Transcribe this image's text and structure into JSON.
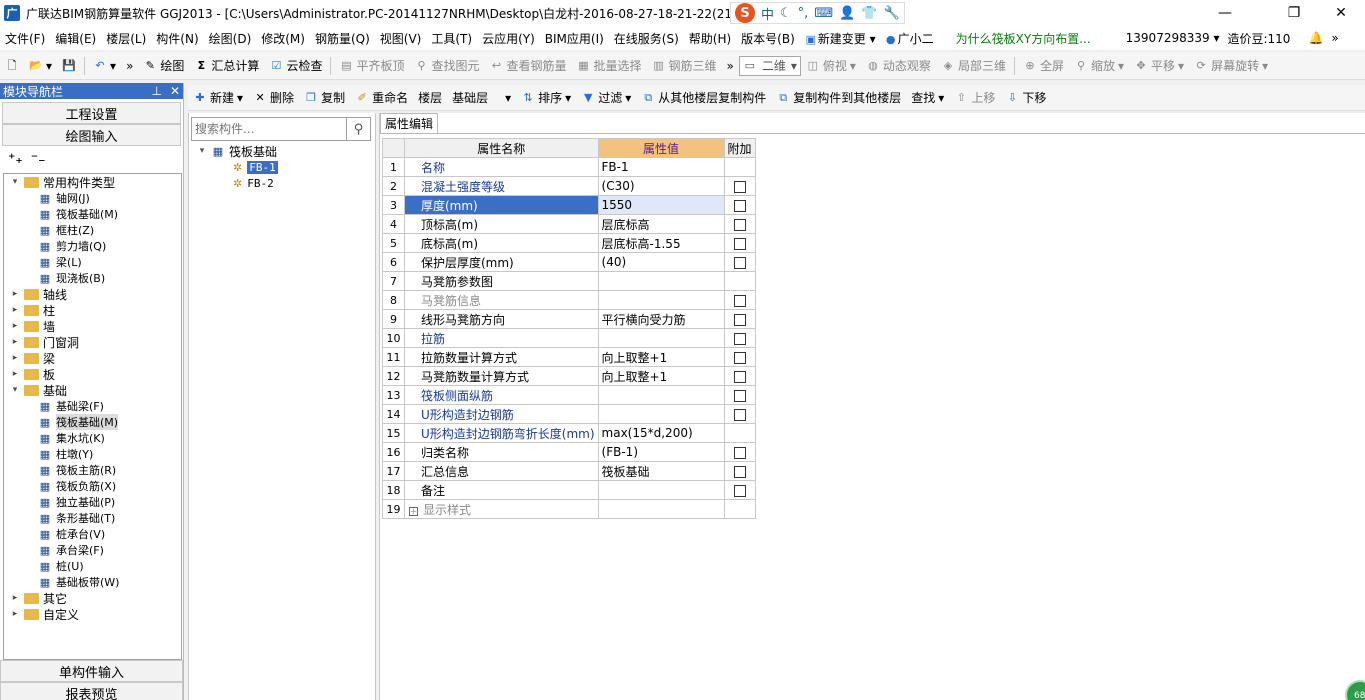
{
  "window": {
    "title": "广联达BIM钢筋算量软件 GGJ2013 - [C:\\Users\\Administrator.PC-20141127NRHM\\Desktop\\白龙村-2016-08-27-18-21-22(2166",
    "minimize": "—",
    "restore": "❐",
    "close": "✕"
  },
  "ime": {
    "logo": "S",
    "items": [
      "中",
      "☾",
      "°,",
      "⌨",
      "👤",
      "👕",
      "🔧"
    ]
  },
  "menu": {
    "items": [
      "文件(F)",
      "编辑(E)",
      "楼层(L)",
      "构件(N)",
      "绘图(D)",
      "修改(M)",
      "钢筋量(Q)",
      "视图(V)",
      "工具(T)",
      "云应用(Y)",
      "BIM应用(I)",
      "在线服务(S)",
      "帮助(H)",
      "版本号(B)"
    ],
    "new_change": "新建变更",
    "guangxiaoer": "广小二",
    "question": "为什么筏板XY方向布置...",
    "phone": "13907298339",
    "beans": "造价豆:110"
  },
  "toolbar1": {
    "draw": "绘图",
    "sum_calc": "汇总计算",
    "cloud_check": "云检查",
    "align_top": "平齐板顶",
    "find_elem": "查找图元",
    "view_rebar": "查看钢筋量",
    "batch_select": "批量选择",
    "rebar_3d": "钢筋三维",
    "view_mode": "二维",
    "top_view": "俯视",
    "dynamic_view": "动态观察",
    "local_3d": "局部三维",
    "fullscreen": "全屏",
    "zoom": "缩放",
    "pan": "平移",
    "rotate": "屏幕旋转"
  },
  "toolbar2": {
    "new": "新建",
    "delete": "删除",
    "copy": "复制",
    "rename": "重命名",
    "floor_label": "楼层",
    "floor_value": "基础层",
    "sort": "排序",
    "filter": "过滤",
    "copy_from_other": "从其他楼层复制构件",
    "copy_to_other": "复制构件到其他楼层",
    "find": "查找",
    "move_up": "上移",
    "move_down": "下移"
  },
  "nav": {
    "header": "模块导航栏",
    "pin": "⊥",
    "close": "✕",
    "project_settings": "工程设置",
    "draw_input": "绘图输入",
    "single_input": "单构件输入",
    "report_preview": "报表预览",
    "tree": [
      {
        "label": "常用构件类型",
        "level": 0,
        "type": "folder",
        "expanded": true
      },
      {
        "label": "轴网(J)",
        "level": 1,
        "type": "item",
        "icon": "grid-icon"
      },
      {
        "label": "筏板基础(M)",
        "level": 1,
        "type": "item",
        "icon": "raft-icon"
      },
      {
        "label": "框柱(Z)",
        "level": 1,
        "type": "item",
        "icon": "column-icon"
      },
      {
        "label": "剪力墙(Q)",
        "level": 1,
        "type": "item",
        "icon": "wall-icon"
      },
      {
        "label": "梁(L)",
        "level": 1,
        "type": "item",
        "icon": "beam-icon"
      },
      {
        "label": "现浇板(B)",
        "level": 1,
        "type": "item",
        "icon": "slab-icon"
      },
      {
        "label": "轴线",
        "level": 0,
        "type": "folder",
        "expanded": false
      },
      {
        "label": "柱",
        "level": 0,
        "type": "folder",
        "expanded": false
      },
      {
        "label": "墙",
        "level": 0,
        "type": "folder",
        "expanded": false
      },
      {
        "label": "门窗洞",
        "level": 0,
        "type": "folder",
        "expanded": false
      },
      {
        "label": "梁",
        "level": 0,
        "type": "folder",
        "expanded": false
      },
      {
        "label": "板",
        "level": 0,
        "type": "folder",
        "expanded": false
      },
      {
        "label": "基础",
        "level": 0,
        "type": "folder",
        "expanded": true
      },
      {
        "label": "基础梁(F)",
        "level": 1,
        "type": "item",
        "icon": "foundation-beam-icon"
      },
      {
        "label": "筏板基础(M)",
        "level": 1,
        "type": "item",
        "icon": "raft-icon",
        "selected": true
      },
      {
        "label": "集水坑(K)",
        "level": 1,
        "type": "item",
        "icon": "sump-icon"
      },
      {
        "label": "柱墩(Y)",
        "level": 1,
        "type": "item",
        "icon": "pier-icon"
      },
      {
        "label": "筏板主筋(R)",
        "level": 1,
        "type": "item",
        "icon": "main-rebar-icon"
      },
      {
        "label": "筏板负筋(X)",
        "level": 1,
        "type": "item",
        "icon": "neg-rebar-icon"
      },
      {
        "label": "独立基础(P)",
        "level": 1,
        "type": "item",
        "icon": "isolated-footing-icon"
      },
      {
        "label": "条形基础(T)",
        "level": 1,
        "type": "item",
        "icon": "strip-footing-icon"
      },
      {
        "label": "桩承台(V)",
        "level": 1,
        "type": "item",
        "icon": "pile-cap-icon"
      },
      {
        "label": "承台梁(F)",
        "level": 1,
        "type": "item",
        "icon": "cap-beam-icon"
      },
      {
        "label": "桩(U)",
        "level": 1,
        "type": "item",
        "icon": "pile-icon"
      },
      {
        "label": "基础板带(W)",
        "level": 1,
        "type": "item",
        "icon": "strip-band-icon"
      },
      {
        "label": "其它",
        "level": 0,
        "type": "folder",
        "expanded": false
      },
      {
        "label": "自定义",
        "level": 0,
        "type": "folder",
        "expanded": false
      }
    ]
  },
  "components": {
    "search_placeholder": "搜索构件...",
    "root": "筏板基础",
    "items": [
      "FB-1",
      "FB-2"
    ]
  },
  "props": {
    "tab": "属性编辑",
    "headers": {
      "name": "属性名称",
      "value": "属性值",
      "extra": "附加"
    },
    "rows": [
      {
        "idx": "1",
        "name": "名称",
        "value": "FB-1",
        "color": "blue",
        "check": false
      },
      {
        "idx": "2",
        "name": "混凝土强度等级",
        "value": "(C30)",
        "color": "blue",
        "check": true
      },
      {
        "idx": "3",
        "name": "厚度(mm)",
        "value": "1550",
        "color": "blue",
        "check": true,
        "selected": true
      },
      {
        "idx": "4",
        "name": "顶标高(m)",
        "value": "层底标高",
        "color": "black",
        "check": true
      },
      {
        "idx": "5",
        "name": "底标高(m)",
        "value": "层底标高-1.55",
        "color": "black",
        "check": true
      },
      {
        "idx": "6",
        "name": "保护层厚度(mm)",
        "value": "(40)",
        "color": "black",
        "check": true
      },
      {
        "idx": "7",
        "name": "马凳筋参数图",
        "value": "",
        "color": "black",
        "check": false
      },
      {
        "idx": "8",
        "name": "马凳筋信息",
        "value": "",
        "color": "gray",
        "check": true
      },
      {
        "idx": "9",
        "name": "线形马凳筋方向",
        "value": "平行横向受力筋",
        "color": "black",
        "check": true
      },
      {
        "idx": "10",
        "name": "拉筋",
        "value": "",
        "color": "blue",
        "check": true
      },
      {
        "idx": "11",
        "name": "拉筋数量计算方式",
        "value": "向上取整+1",
        "color": "black",
        "check": true
      },
      {
        "idx": "12",
        "name": "马凳筋数量计算方式",
        "value": "向上取整+1",
        "color": "black",
        "check": true
      },
      {
        "idx": "13",
        "name": "筏板侧面纵筋",
        "value": "",
        "color": "blue",
        "check": true
      },
      {
        "idx": "14",
        "name": "U形构造封边钢筋",
        "value": "",
        "color": "blue",
        "check": true
      },
      {
        "idx": "15",
        "name": "U形构造封边钢筋弯折长度(mm)",
        "value": "max(15*d,200)",
        "color": "blue",
        "check": false
      },
      {
        "idx": "16",
        "name": "归类名称",
        "value": "(FB-1)",
        "color": "black",
        "check": true
      },
      {
        "idx": "17",
        "name": "汇总信息",
        "value": "筏板基础",
        "color": "black",
        "check": true
      },
      {
        "idx": "18",
        "name": "备注",
        "value": "",
        "color": "black",
        "check": true
      },
      {
        "idx": "19",
        "name": "显示样式",
        "value": "",
        "color": "gray",
        "check": false,
        "expandable": true
      }
    ]
  },
  "badge": "68"
}
